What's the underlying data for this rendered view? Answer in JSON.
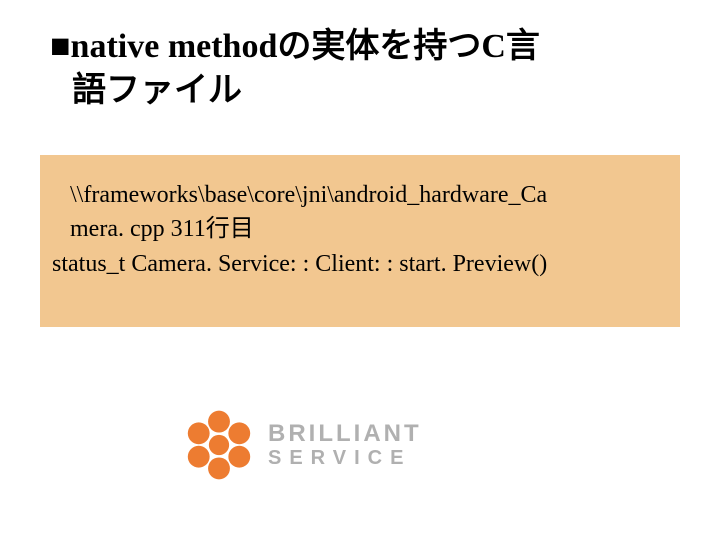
{
  "heading": {
    "bullet": "■",
    "line1": "native methodの実体を持つC言",
    "line2": "語ファイル"
  },
  "code": {
    "path_line1": "\\\\frameworks\\base\\core\\jni\\android_hardware_Ca",
    "path_line2": "mera. cpp  311行目",
    "code_line": "status_t Camera. Service: : Client: : start. Preview()"
  },
  "logo": {
    "line1": "BRILLIANT",
    "line2": "SERVICE",
    "mark_color": "#ed7c31",
    "text_color": "#b0b0b0",
    "name": "Brilliant Service"
  }
}
